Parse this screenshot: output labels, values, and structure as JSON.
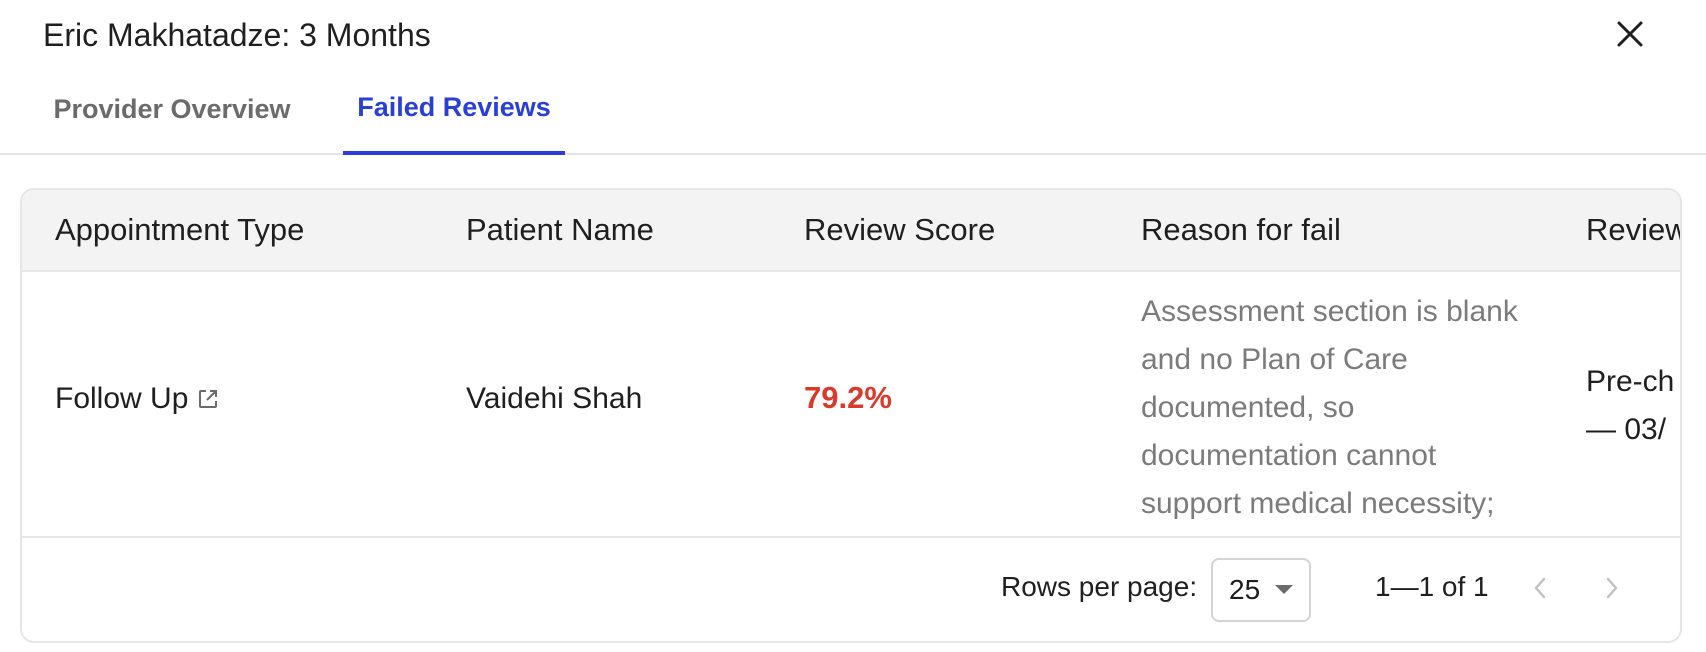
{
  "dialog": {
    "title": "Eric Makhatadze: 3 Months"
  },
  "tabs": [
    {
      "label": "Provider Overview",
      "active": false
    },
    {
      "label": "Failed Reviews",
      "active": true
    }
  ],
  "table": {
    "columns": [
      "Appointment Type",
      "Patient Name",
      "Review Score",
      "Reason for fail",
      "Review"
    ],
    "rows": [
      {
        "appointment_type": "Follow Up",
        "patient_name": "Vaidehi Shah",
        "review_score": "79.2%",
        "reason": "Assessment section is blank and no Plan of Care documented, so documentation cannot support medical necessity;",
        "reviewed_line1": "Pre-ch",
        "reviewed_line2": "— 03/"
      }
    ]
  },
  "pagination": {
    "rows_per_page_label": "Rows per page:",
    "rows_per_page_value": "25",
    "range": "1—1 of 1"
  },
  "colors": {
    "accent": "#2a3fd8",
    "fail_score": "#d93a2b"
  },
  "icons": {
    "close": "close-icon",
    "external_link": "external-link-icon",
    "dropdown": "caret-down-icon",
    "prev": "chevron-left-icon",
    "next": "chevron-right-icon"
  }
}
